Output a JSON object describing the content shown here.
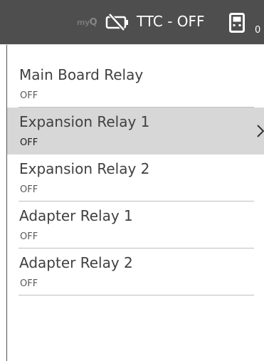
{
  "header": {
    "brand_prefix": "my",
    "brand_suffix": "Q",
    "battery_icon": "battery-off-icon",
    "status_text": "TTC - OFF",
    "device_icon": "device-icon",
    "device_count": "0"
  },
  "relays": [
    {
      "name": "Main Board Relay",
      "status": "OFF",
      "selected": false
    },
    {
      "name": "Expansion Relay 1",
      "status": "OFF",
      "selected": true
    },
    {
      "name": "Expansion Relay 2",
      "status": "OFF",
      "selected": false
    },
    {
      "name": "Adapter Relay 1",
      "status": "OFF",
      "selected": false
    },
    {
      "name": "Adapter Relay 2",
      "status": "OFF",
      "selected": false
    }
  ],
  "colors": {
    "header_bg": "#4e4e4e",
    "selected_bg": "#d7d7d7",
    "text": "#404040"
  }
}
